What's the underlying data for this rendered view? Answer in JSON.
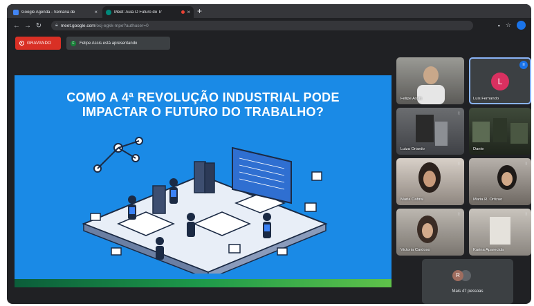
{
  "browser": {
    "tabs": [
      {
        "title": "Google Agenda - Semana de",
        "active": false,
        "favicon_color": "#4285f4"
      },
      {
        "title": "Meet: Aula O Futuro do Tr",
        "active": true,
        "favicon_color": "#00897b"
      }
    ],
    "new_tab_symbol": "+",
    "close_symbol": "×",
    "url_host": "meet.google.com",
    "url_path": "/ocj-egkk-mpe?authuser=0"
  },
  "meet": {
    "recording_label": "GRAVANDO",
    "presenter_initial": "F",
    "presenting_text": "Felipe Assis está apresentando"
  },
  "slide": {
    "title_line1": "COMO A 4ª REVOLUÇÃO INDUSTRIAL PODE",
    "title_line2": "IMPACTAR O FUTURO DO TRABALHO?",
    "background": "#1a8ae6"
  },
  "participants": [
    {
      "name": "Felipe Assis"
    },
    {
      "name": "Luis Fernando",
      "initial": "L"
    },
    {
      "name": "Luiza Oriardo"
    },
    {
      "name": "Dante"
    },
    {
      "name": "Maria Cabral"
    },
    {
      "name": "Maria R. Ortizao"
    },
    {
      "name": "Victoria Cardoso"
    },
    {
      "name": "Karina Aparecida"
    }
  ],
  "more": {
    "initial": "R",
    "label": "Mais 47 pessoas"
  },
  "colors": {
    "recording": "#d93025",
    "speaking_outline": "#8ab4f8",
    "meet_background": "#202124"
  }
}
